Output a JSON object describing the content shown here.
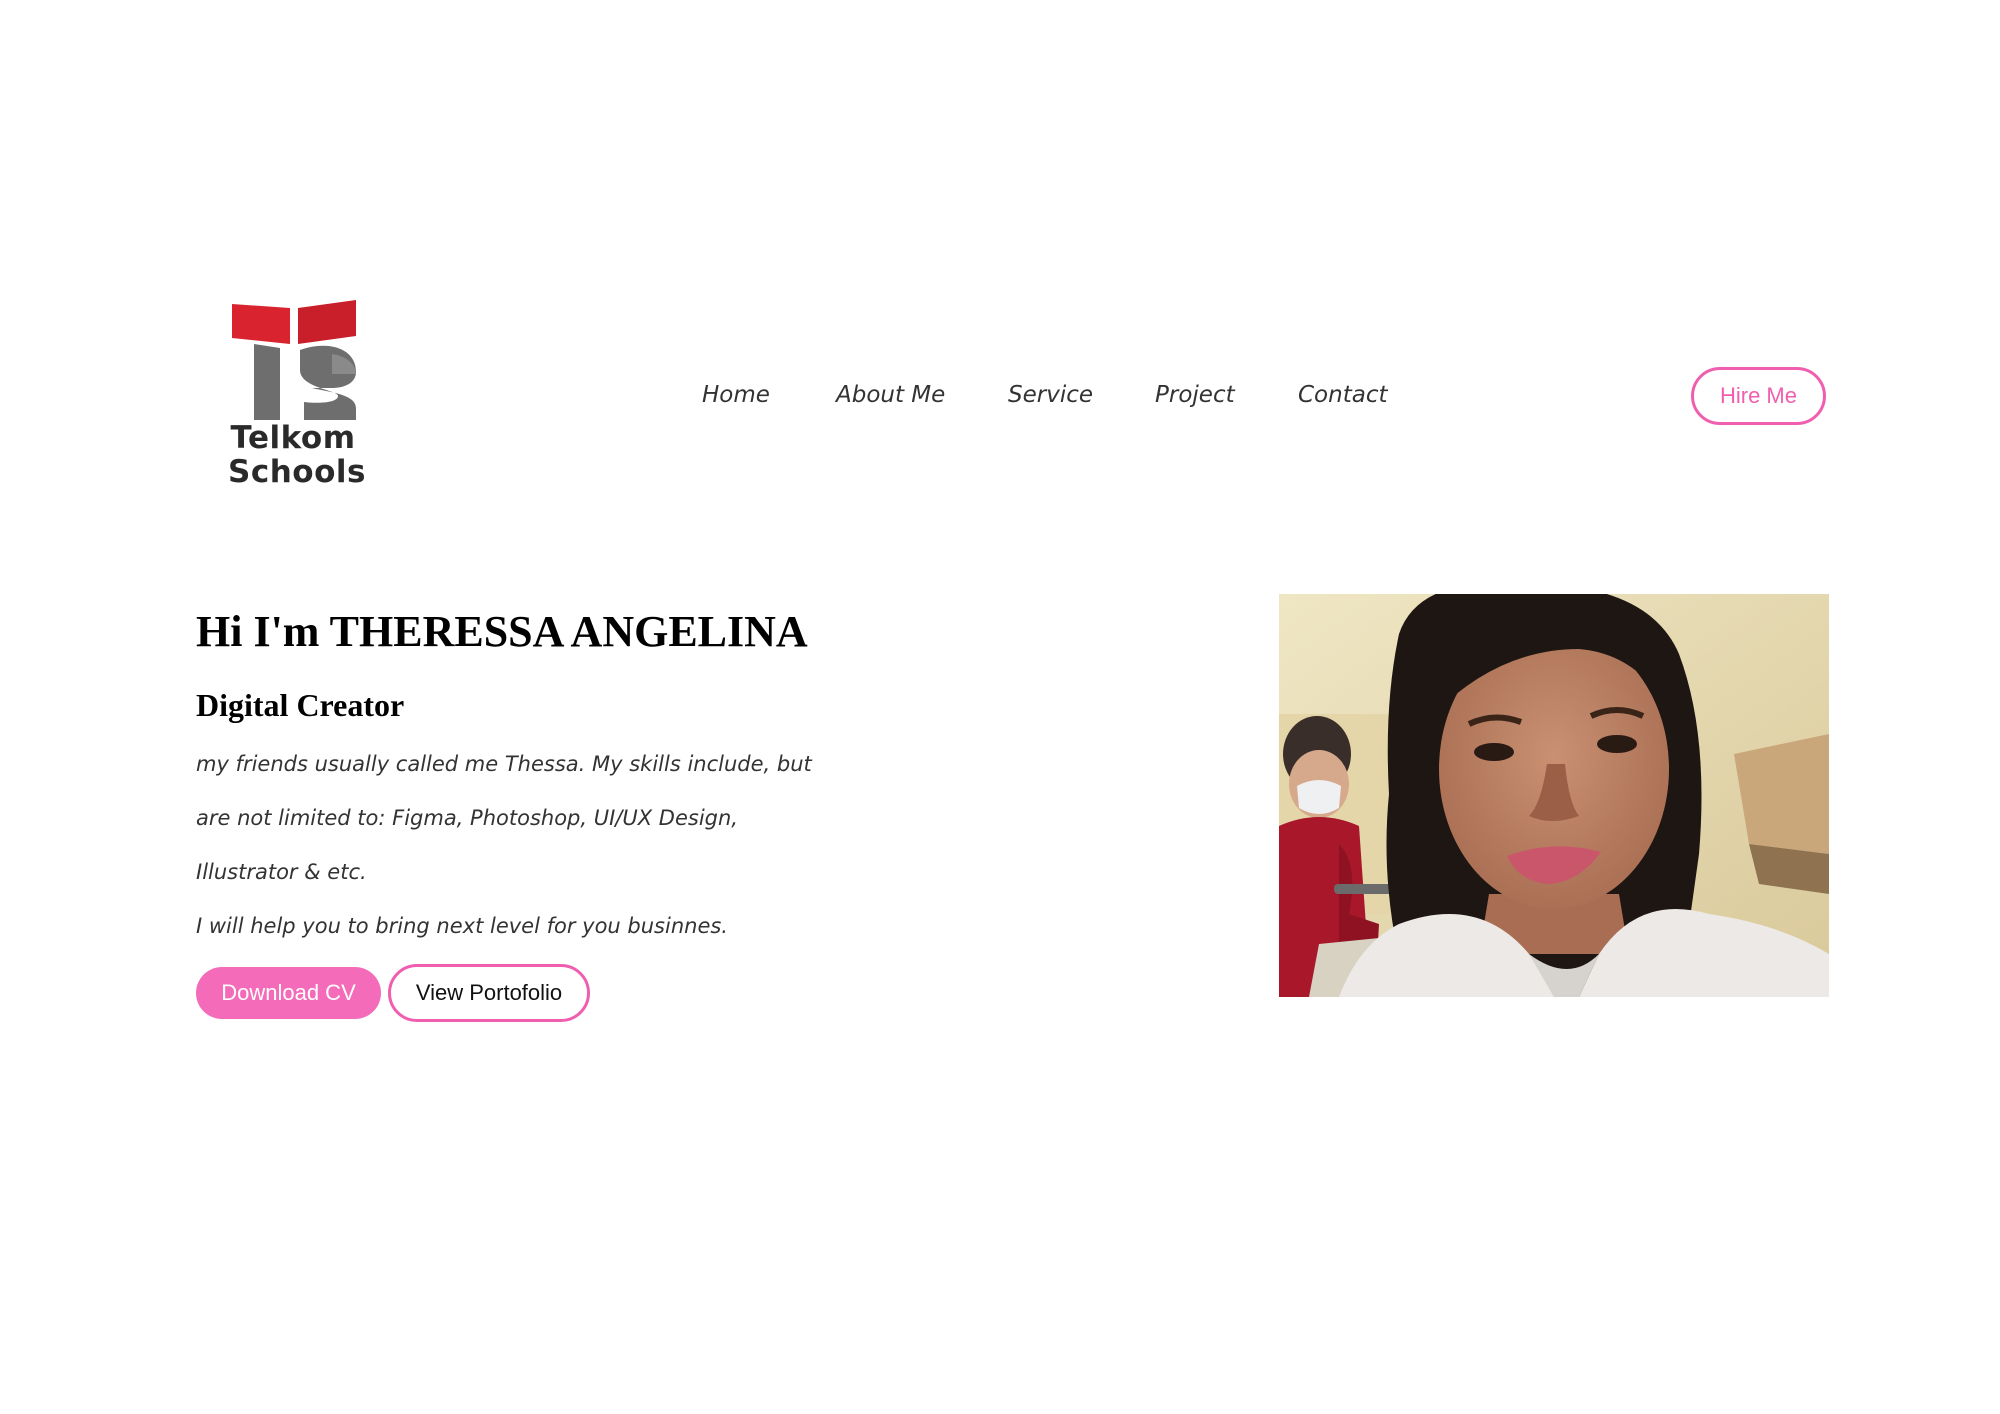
{
  "logo": {
    "line1": "Telkom",
    "line2": "Schools",
    "colors": {
      "red": "#d9232e",
      "grey": "#6e6e6e",
      "text": "#2a2a2a"
    }
  },
  "nav": {
    "items": [
      {
        "label": "Home"
      },
      {
        "label": "About Me"
      },
      {
        "label": "Service"
      },
      {
        "label": "Project"
      },
      {
        "label": "Contact"
      }
    ]
  },
  "header": {
    "hire_label": "Hire Me"
  },
  "hero": {
    "title": "Hi I'm THERESSA ANGELINA",
    "subtitle": "Digital Creator",
    "description_lines": [
      "my friends usually called me Thessa. My skills include, but",
      "are not limited to: Figma, Photoshop, UI/UX Design,",
      "Illustrator & etc.",
      "I will help you to bring next level for you businnes."
    ],
    "download_label": "Download CV",
    "portfolio_label": "View Portofolio"
  },
  "theme": {
    "accent": "#f05faf",
    "accent_fill": "#f36bb9",
    "text": "#333333",
    "background": "#ffffff"
  }
}
